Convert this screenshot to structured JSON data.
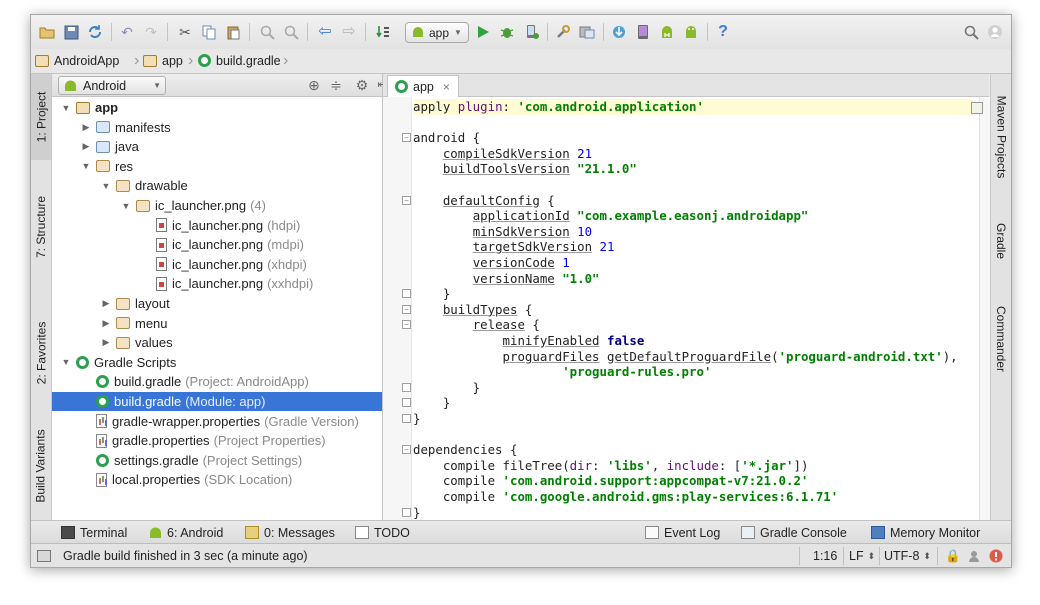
{
  "toolbar": {
    "run_config_label": "app",
    "icons": [
      "open-icon",
      "save-icon",
      "sync-icon",
      "undo-icon",
      "redo-icon",
      "cut-icon",
      "copy-icon",
      "paste-icon",
      "find-icon",
      "replace-icon",
      "back-icon",
      "forward-icon",
      "make-icon",
      "android-icon",
      "run-icon",
      "debug-icon",
      "attach-debugger-icon",
      "project-structure-icon",
      "sdk-manager-icon",
      "android-device-monitor-icon",
      "avd-manager-icon",
      "sync-gradle-icon",
      "android-sdk-icon",
      "help-icon",
      "search-icon"
    ]
  },
  "breadcrumbs": [
    "AndroidApp",
    "app",
    "build.gradle"
  ],
  "left_tabs": [
    "1: Project",
    "7: Structure",
    "2: Favorites",
    "Build Variants"
  ],
  "right_tabs": [
    "Maven Projects",
    "Gradle",
    "Commander"
  ],
  "project_panel": {
    "view_selector": "Android",
    "tree": [
      {
        "label": "app",
        "detail": "",
        "depth": 0,
        "expander": "open",
        "icon": "module"
      },
      {
        "label": "manifests",
        "detail": "",
        "depth": 1,
        "expander": "closed",
        "icon": "folder"
      },
      {
        "label": "java",
        "detail": "",
        "depth": 1,
        "expander": "closed",
        "icon": "folder"
      },
      {
        "label": "res",
        "detail": "",
        "depth": 1,
        "expander": "open",
        "icon": "res"
      },
      {
        "label": "drawable",
        "detail": "",
        "depth": 2,
        "expander": "open",
        "icon": "res"
      },
      {
        "label": "ic_launcher.png",
        "detail": "(4)",
        "depth": 3,
        "expander": "open",
        "icon": "res"
      },
      {
        "label": "ic_launcher.png",
        "detail": "(hdpi)",
        "depth": 4,
        "expander": "none",
        "icon": "png"
      },
      {
        "label": "ic_launcher.png",
        "detail": "(mdpi)",
        "depth": 4,
        "expander": "none",
        "icon": "png"
      },
      {
        "label": "ic_launcher.png",
        "detail": "(xhdpi)",
        "depth": 4,
        "expander": "none",
        "icon": "png"
      },
      {
        "label": "ic_launcher.png",
        "detail": "(xxhdpi)",
        "depth": 4,
        "expander": "none",
        "icon": "png"
      },
      {
        "label": "layout",
        "detail": "",
        "depth": 2,
        "expander": "closed",
        "icon": "res"
      },
      {
        "label": "menu",
        "detail": "",
        "depth": 2,
        "expander": "closed",
        "icon": "res"
      },
      {
        "label": "values",
        "detail": "",
        "depth": 2,
        "expander": "closed",
        "icon": "res"
      },
      {
        "label": "Gradle Scripts",
        "detail": "",
        "depth": 0,
        "expander": "open",
        "icon": "gradle"
      },
      {
        "label": "build.gradle",
        "detail": "(Project: AndroidApp)",
        "depth": 1,
        "expander": "none",
        "icon": "gradle"
      },
      {
        "label": "build.gradle",
        "detail": "(Module: app)",
        "depth": 1,
        "expander": "none",
        "icon": "gradle",
        "selected": true
      },
      {
        "label": "gradle-wrapper.properties",
        "detail": "(Gradle Version)",
        "depth": 1,
        "expander": "none",
        "icon": "props"
      },
      {
        "label": "gradle.properties",
        "detail": "(Project Properties)",
        "depth": 1,
        "expander": "none",
        "icon": "props"
      },
      {
        "label": "settings.gradle",
        "detail": "(Project Settings)",
        "depth": 1,
        "expander": "none",
        "icon": "gradle"
      },
      {
        "label": "local.properties",
        "detail": "(SDK Location)",
        "depth": 1,
        "expander": "none",
        "icon": "props"
      }
    ]
  },
  "editor": {
    "tab_label": "app",
    "lines": [
      [
        {
          "t": "apply ",
          "c": ""
        },
        {
          "t": "plugin",
          "c": "prop"
        },
        {
          "t": ": ",
          "c": ""
        },
        {
          "t": "'com.android.application'",
          "c": "str"
        }
      ],
      [],
      [
        {
          "t": "android {",
          "c": ""
        }
      ],
      [
        {
          "t": "    ",
          "c": ""
        },
        {
          "t": "compileSdkVersion",
          "c": "und"
        },
        {
          "t": " ",
          "c": ""
        },
        {
          "t": "21",
          "c": "num"
        }
      ],
      [
        {
          "t": "    ",
          "c": ""
        },
        {
          "t": "buildToolsVersion",
          "c": "und"
        },
        {
          "t": " ",
          "c": ""
        },
        {
          "t": "\"21.1.0\"",
          "c": "str"
        }
      ],
      [],
      [
        {
          "t": "    ",
          "c": ""
        },
        {
          "t": "defaultConfig",
          "c": "und"
        },
        {
          "t": " {",
          "c": ""
        }
      ],
      [
        {
          "t": "        ",
          "c": ""
        },
        {
          "t": "applicationId",
          "c": "und"
        },
        {
          "t": " ",
          "c": ""
        },
        {
          "t": "\"com.example.easonj.androidapp\"",
          "c": "str"
        }
      ],
      [
        {
          "t": "        ",
          "c": ""
        },
        {
          "t": "minSdkVersion",
          "c": "und"
        },
        {
          "t": " ",
          "c": ""
        },
        {
          "t": "10",
          "c": "num"
        }
      ],
      [
        {
          "t": "        ",
          "c": ""
        },
        {
          "t": "targetSdkVersion",
          "c": "und"
        },
        {
          "t": " ",
          "c": ""
        },
        {
          "t": "21",
          "c": "num"
        }
      ],
      [
        {
          "t": "        ",
          "c": ""
        },
        {
          "t": "versionCode",
          "c": "und"
        },
        {
          "t": " ",
          "c": ""
        },
        {
          "t": "1",
          "c": "num"
        }
      ],
      [
        {
          "t": "        ",
          "c": ""
        },
        {
          "t": "versionName",
          "c": "und"
        },
        {
          "t": " ",
          "c": ""
        },
        {
          "t": "\"1.0\"",
          "c": "str"
        }
      ],
      [
        {
          "t": "    }",
          "c": ""
        }
      ],
      [
        {
          "t": "    ",
          "c": ""
        },
        {
          "t": "buildTypes",
          "c": "und"
        },
        {
          "t": " {",
          "c": ""
        }
      ],
      [
        {
          "t": "        ",
          "c": ""
        },
        {
          "t": "release",
          "c": "und"
        },
        {
          "t": " {",
          "c": ""
        }
      ],
      [
        {
          "t": "            ",
          "c": ""
        },
        {
          "t": "minifyEnabled",
          "c": "und"
        },
        {
          "t": " ",
          "c": ""
        },
        {
          "t": "false",
          "c": "kw"
        }
      ],
      [
        {
          "t": "            ",
          "c": ""
        },
        {
          "t": "proguardFiles",
          "c": "und"
        },
        {
          "t": " ",
          "c": ""
        },
        {
          "t": "getDefaultProguardFile",
          "c": "und"
        },
        {
          "t": "(",
          "c": ""
        },
        {
          "t": "'proguard-android.txt'",
          "c": "str"
        },
        {
          "t": "),",
          "c": ""
        }
      ],
      [
        {
          "t": "                    ",
          "c": ""
        },
        {
          "t": "'proguard-rules.pro'",
          "c": "str"
        }
      ],
      [
        {
          "t": "        }",
          "c": ""
        }
      ],
      [
        {
          "t": "    }",
          "c": ""
        }
      ],
      [
        {
          "t": "}",
          "c": ""
        }
      ],
      [],
      [
        {
          "t": "dependencies {",
          "c": ""
        }
      ],
      [
        {
          "t": "    compile fileTree(",
          "c": ""
        },
        {
          "t": "dir",
          "c": "prop"
        },
        {
          "t": ": ",
          "c": ""
        },
        {
          "t": "'libs'",
          "c": "str"
        },
        {
          "t": ", ",
          "c": ""
        },
        {
          "t": "include",
          "c": "prop"
        },
        {
          "t": ": [",
          "c": ""
        },
        {
          "t": "'*.jar'",
          "c": "str"
        },
        {
          "t": "])",
          "c": ""
        }
      ],
      [
        {
          "t": "    compile ",
          "c": ""
        },
        {
          "t": "'com.android.support:appcompat-v7:21.0.2'",
          "c": "str"
        }
      ],
      [
        {
          "t": "    compile ",
          "c": ""
        },
        {
          "t": "'com.google.android.gms:play-services:6.1.71'",
          "c": "str"
        }
      ],
      [
        {
          "t": "}",
          "c": ""
        }
      ]
    ]
  },
  "bottom_tools": {
    "terminal": "Terminal",
    "android": "6: Android",
    "messages": "0: Messages",
    "todo": "TODO",
    "event_log": "Event Log",
    "gradle_console": "Gradle Console",
    "memory_monitor": "Memory Monitor"
  },
  "status": {
    "message": "Gradle build finished in 3 sec (a minute ago)",
    "position": "1:16",
    "line_separator": "LF",
    "encoding": "UTF-8"
  },
  "colors": {
    "selection": "#3875d7",
    "string": "#008000",
    "number": "#0000ff",
    "keyword": "#000080",
    "android_green": "#8ab929",
    "run_green": "#2fa33f"
  }
}
